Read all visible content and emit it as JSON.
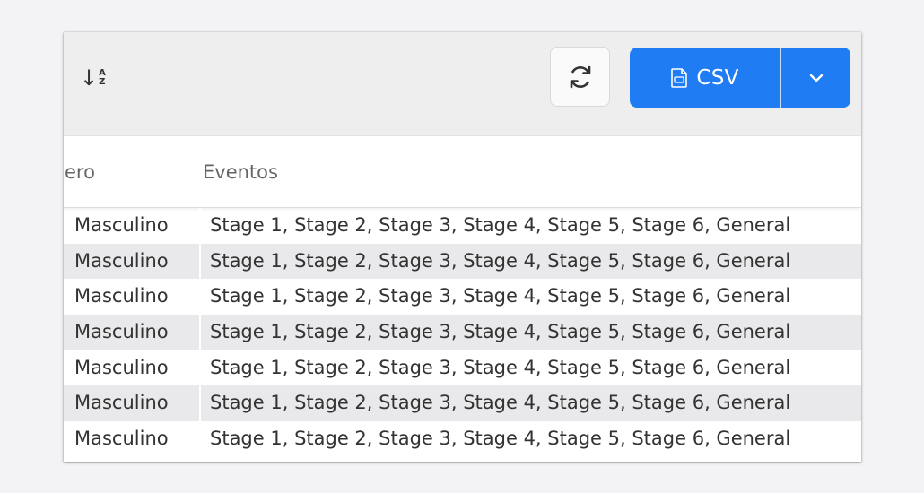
{
  "toolbar": {
    "sort_icon": "sort-alpha-down-icon",
    "sort_letter_top": "A",
    "sort_letter_bottom": "Z",
    "refresh_icon": "refresh-icon",
    "csv_label": "CSV",
    "csv_icon": "csv-file-icon",
    "dropdown_icon": "chevron-down-icon",
    "accent_color": "#1f7cf3"
  },
  "table": {
    "columns": [
      "ero",
      "Eventos"
    ],
    "rows": [
      {
        "genero": "Masculino",
        "eventos": "Stage 1, Stage 2, Stage 3, Stage 4, Stage 5, Stage 6, General"
      },
      {
        "genero": "Masculino",
        "eventos": "Stage 1, Stage 2, Stage 3, Stage 4, Stage 5, Stage 6, General"
      },
      {
        "genero": "Masculino",
        "eventos": "Stage 1, Stage 2, Stage 3, Stage 4, Stage 5, Stage 6, General"
      },
      {
        "genero": "Masculino",
        "eventos": "Stage 1, Stage 2, Stage 3, Stage 4, Stage 5, Stage 6, General"
      },
      {
        "genero": "Masculino",
        "eventos": "Stage 1, Stage 2, Stage 3, Stage 4, Stage 5, Stage 6, General"
      },
      {
        "genero": "Masculino",
        "eventos": "Stage 1, Stage 2, Stage 3, Stage 4, Stage 5, Stage 6, General"
      },
      {
        "genero": "Masculino",
        "eventos": "Stage 1, Stage 2, Stage 3, Stage 4, Stage 5, Stage 6, General"
      }
    ]
  }
}
